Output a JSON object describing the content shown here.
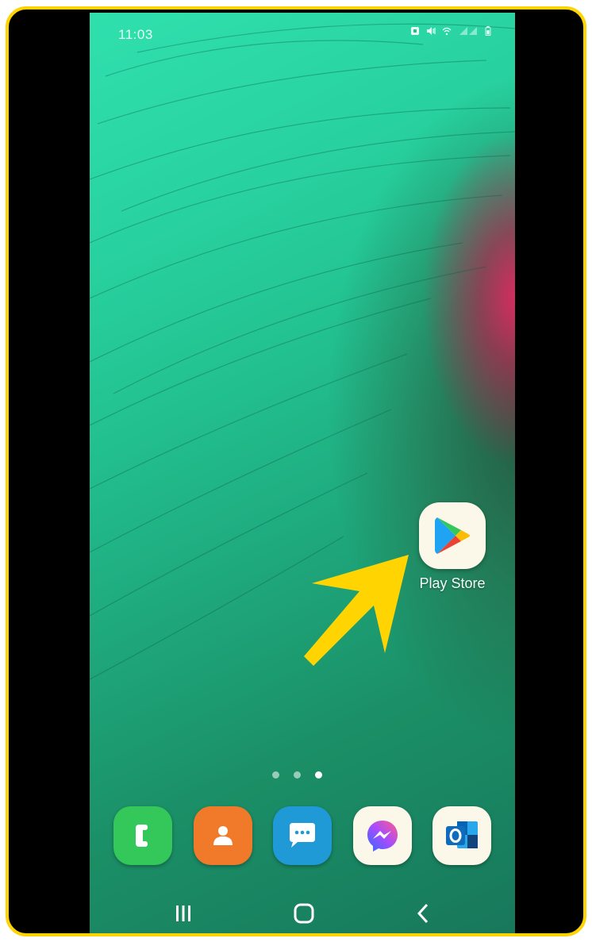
{
  "status_bar": {
    "time": "11:03",
    "icons": [
      "alarm-icon",
      "mute-icon",
      "wifi-icon",
      "signal-icon",
      "battery-icon"
    ]
  },
  "home": {
    "apps": [
      {
        "label": "Play Store",
        "icon": "play-store-icon"
      }
    ],
    "annotation": {
      "type": "arrow",
      "color": "#ffd400",
      "points_to": "Play Store"
    },
    "page_indicator": {
      "count": 3,
      "active_index": 2
    }
  },
  "dock": [
    {
      "name": "Phone",
      "icon": "phone-icon",
      "color": "#34c759"
    },
    {
      "name": "Contacts",
      "icon": "contacts-icon",
      "color": "#f07a2a"
    },
    {
      "name": "Messages",
      "icon": "messages-icon",
      "color": "#1f9ad6"
    },
    {
      "name": "Messenger",
      "icon": "messenger-icon",
      "color": "#fbf7e9"
    },
    {
      "name": "Outlook",
      "icon": "outlook-icon",
      "color": "#fbf7e9"
    }
  ],
  "nav_bar": {
    "buttons": [
      "recents-icon",
      "home-icon",
      "back-icon"
    ]
  },
  "colors": {
    "frame_border": "#ffd400",
    "wallpaper_primary": "#22bf8e",
    "wallpaper_accent": "#e22860"
  }
}
